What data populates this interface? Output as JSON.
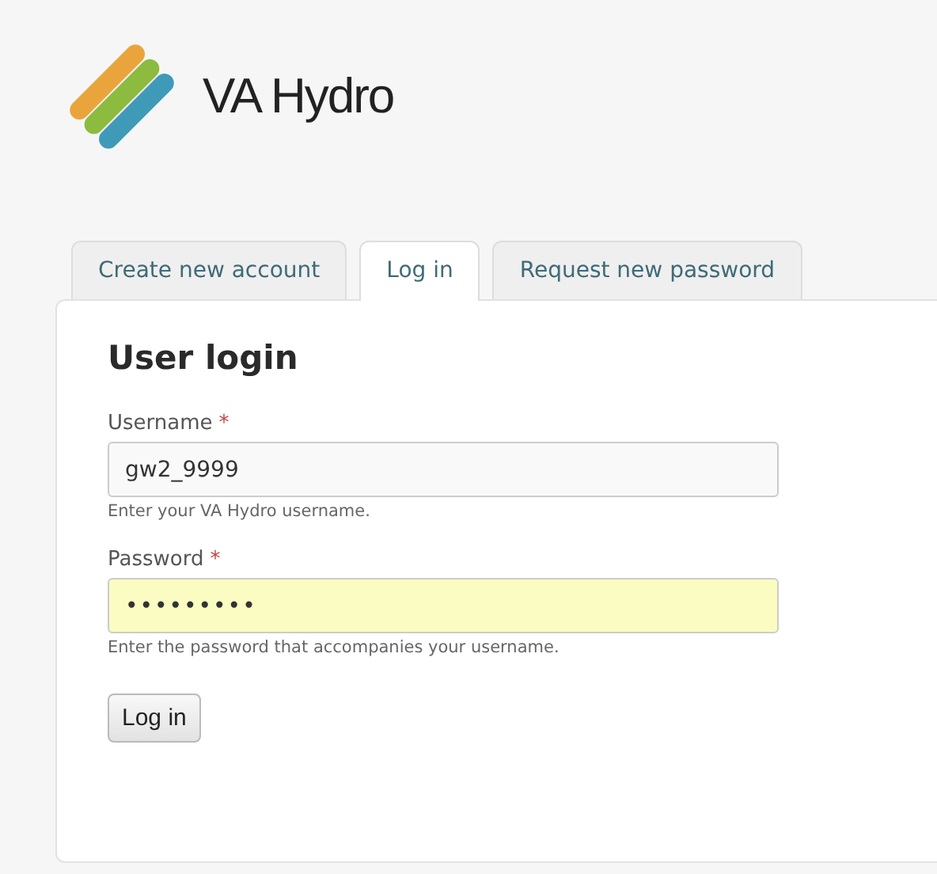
{
  "site": {
    "name": "VA Hydro"
  },
  "tabs": [
    {
      "label": "Create new account",
      "selected": false
    },
    {
      "label": "Log in",
      "selected": true
    },
    {
      "label": "Request new password",
      "selected": false
    }
  ],
  "form": {
    "title": "User login",
    "fields": [
      {
        "label": "Username",
        "required_mark": "*",
        "value": "gw2_9999",
        "hint": "Enter your VA Hydro username.",
        "autofilled": false
      },
      {
        "label": "Password",
        "required_mark": "*",
        "value": "•••••••••",
        "hint": "Enter the password that accompanies your username.",
        "autofilled": true
      }
    ],
    "submit": "Log in"
  }
}
